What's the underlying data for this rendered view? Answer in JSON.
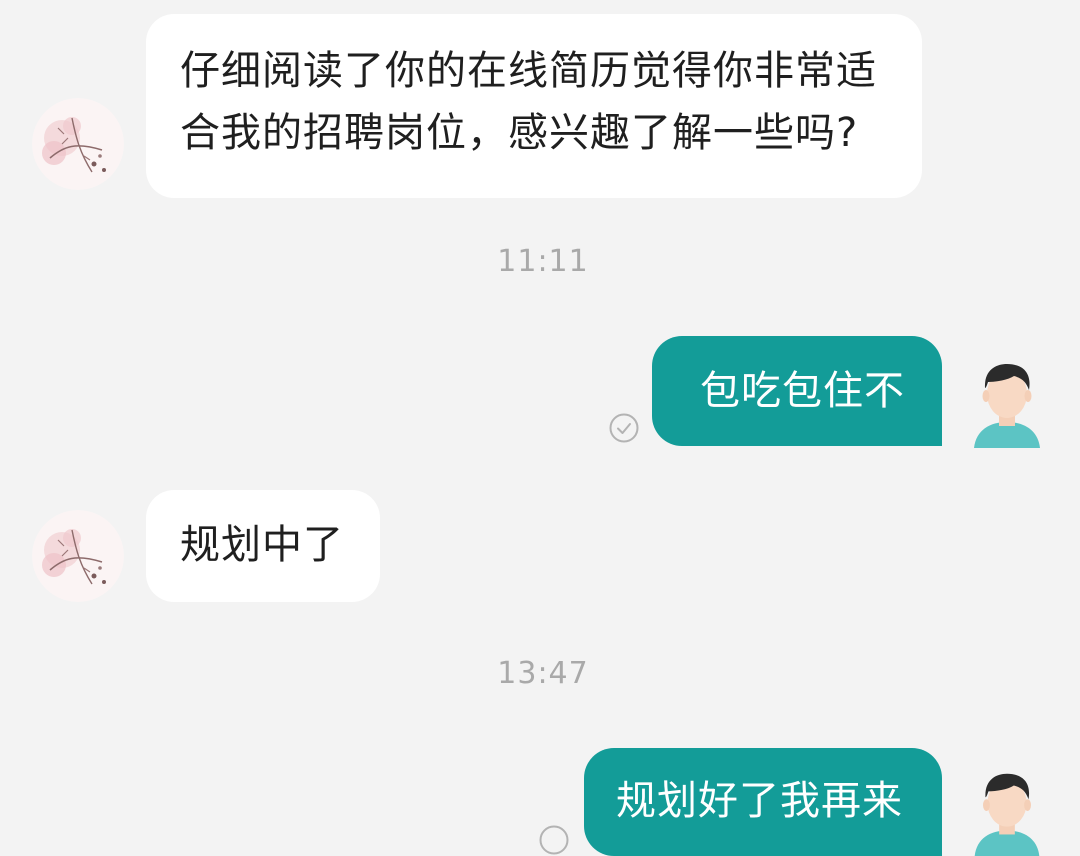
{
  "conversation": {
    "messages": [
      {
        "sender": "recruiter",
        "lines": [
          "仔细阅读了你的在线简历觉得你非常适",
          "合我的招聘岗位，感兴趣了解一些吗?"
        ],
        "avatar": "plum-blossom-avatar-icon"
      },
      {
        "type": "timestamp",
        "text": "11:11"
      },
      {
        "sender": "me",
        "text": "包吃包住不",
        "status": "read-check-icon",
        "avatar": "man-avatar-icon"
      },
      {
        "sender": "recruiter",
        "text": "规划中了",
        "avatar": "plum-blossom-avatar-icon"
      },
      {
        "type": "timestamp",
        "text": "13:47"
      },
      {
        "sender": "me",
        "text": "规划好了我再来",
        "status": "unread-circle-icon",
        "avatar": "man-avatar-icon"
      }
    ]
  },
  "colors": {
    "background": "#f3f3f3",
    "incoming_bubble": "#ffffff",
    "outgoing_bubble": "#139c98",
    "timestamp_text": "#a9a9a9",
    "avatar_shirt": "#5cc4c4"
  }
}
